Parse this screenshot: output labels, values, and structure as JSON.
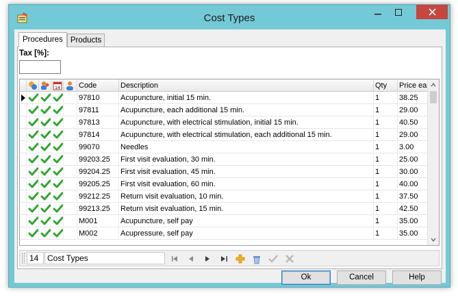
{
  "window": {
    "title": "Cost Types"
  },
  "tabs": [
    {
      "label": "Procedures"
    },
    {
      "label": "Products"
    }
  ],
  "tax": {
    "label": "Tax [%]:",
    "value": ""
  },
  "grid": {
    "columns": {
      "code": "Code",
      "description": "Description",
      "qty": "Qty",
      "price": "Price ea"
    },
    "rows": [
      {
        "code": "97810",
        "description": "Acupuncture, initial 15 min.",
        "qty": "1",
        "price": "38.25"
      },
      {
        "code": "97811",
        "description": "Acupuncture, each additional 15 min.",
        "qty": "1",
        "price": "29.00"
      },
      {
        "code": "97813",
        "description": "Acupuncture, with electrical stimulation, initial 15 min.",
        "qty": "1",
        "price": "40.50"
      },
      {
        "code": "97814",
        "description": "Acupuncture, with electrical stimulation, each additional 15 min.",
        "qty": "1",
        "price": "29.00"
      },
      {
        "code": "99070",
        "description": "Needles",
        "qty": "1",
        "price": "3.00"
      },
      {
        "code": "99203.25",
        "description": "First visit evaluation, 30 min.",
        "qty": "1",
        "price": "25.00"
      },
      {
        "code": "99204.25",
        "description": "First visit evaluation, 45 min.",
        "qty": "1",
        "price": "30.00"
      },
      {
        "code": "99205.25",
        "description": "First visit evaluation, 60 min.",
        "qty": "1",
        "price": "40.00"
      },
      {
        "code": "99212.25",
        "description": "Return visit evaluation, 10 min.",
        "qty": "1",
        "price": "37.50"
      },
      {
        "code": "99213.25",
        "description": "Return visit evaluation, 15 min.",
        "qty": "1",
        "price": "42.50"
      },
      {
        "code": "M001",
        "description": "Acupuncture, self pay",
        "qty": "1",
        "price": "35.00"
      },
      {
        "code": "M002",
        "description": "Acupressure, self pay",
        "qty": "1",
        "price": "35.00"
      }
    ]
  },
  "navigator": {
    "count": "14",
    "label": "Cost Types"
  },
  "buttons": {
    "ok": "Ok",
    "cancel": "Cancel",
    "help": "Help"
  },
  "colors": {
    "check": "#2fa52f",
    "accent": "#74c9d6"
  }
}
